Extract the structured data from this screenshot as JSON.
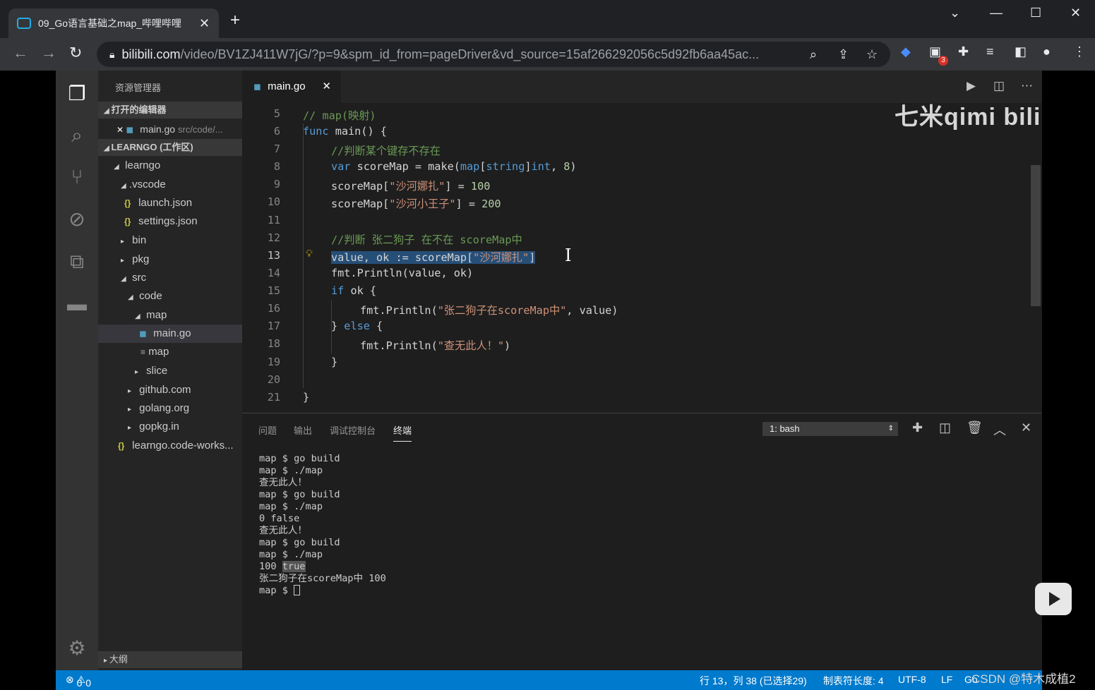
{
  "browser": {
    "tab_title": "09_Go语言基础之map_哔哩哔哩",
    "tab_close": "✕",
    "new_tab": "+",
    "url_domain": "bilibili.com",
    "url_path": "/video/BV1ZJ411W7jG/?p=9&spm_id_from=pageDriver&vd_source=15af266292056c5d92fb6aa45ac...",
    "extension_badge": "3"
  },
  "vscode": {
    "explorer_title": "资源管理器",
    "open_editors": "打开的编辑器",
    "open_file": "main.go",
    "open_file_path": "src/code/...",
    "workspace": "LEARNGO (工作区)",
    "tree": [
      {
        "label": "learngo"
      },
      {
        "label": ".vscode"
      },
      {
        "label": "launch.json"
      },
      {
        "label": "settings.json"
      },
      {
        "label": "bin"
      },
      {
        "label": "pkg"
      },
      {
        "label": "src"
      },
      {
        "label": "code"
      },
      {
        "label": "map"
      },
      {
        "label": "main.go"
      },
      {
        "label": "map"
      },
      {
        "label": "slice"
      },
      {
        "label": "github.com"
      },
      {
        "label": "golang.org"
      },
      {
        "label": "gopkg.in"
      },
      {
        "label": "learngo.code-works..."
      }
    ],
    "outline": "大纲",
    "editor_tab": "main.go",
    "line_numbers": [
      "5",
      "6",
      "7",
      "8",
      "9",
      "10",
      "11",
      "12",
      "13",
      "14",
      "15",
      "16",
      "17",
      "18",
      "19",
      "20",
      "21"
    ],
    "code": {
      "l5": "// map(映射)",
      "l6a": "func",
      "l6b": " main() {",
      "l7": "//判断某个键存不存在",
      "l8a": "var",
      "l8b": " scoreMap = make(",
      "l8c": "map",
      "l8d": "[",
      "l8e": "string",
      "l8f": "]",
      "l8g": "int",
      "l8h": ", ",
      "l8i": "8",
      "l8j": ")",
      "l9a": "scoreMap[",
      "l9b": "\"沙河娜扎\"",
      "l9c": "] = ",
      "l9d": "100",
      "l10a": "scoreMap[",
      "l10b": "\"沙河小王子\"",
      "l10c": "] = ",
      "l10d": "200",
      "l12": "//判断 张二狗子 在不在 scoreMap中",
      "l13a": "value, ok := scoreMap[",
      "l13b": "\"沙河娜扎\"",
      "l13c": "]",
      "l14": "fmt.Println(value, ok)",
      "l15a": "if",
      "l15b": " ok {",
      "l16a": "fmt.Println(",
      "l16b": "\"张二狗子在scoreMap中\"",
      "l16c": ", value)",
      "l17a": "} ",
      "l17b": "else",
      "l17c": " {",
      "l18a": "fmt.Println(",
      "l18b": "\"查无此人！\"",
      "l18c": ")",
      "l19": "}",
      "l21": "}"
    },
    "watermark": "七米qimi bilibili",
    "panel_tabs": [
      "问题",
      "输出",
      "调试控制台",
      "终端"
    ],
    "terminal_select": "1: bash",
    "terminal_lines": [
      "map $ go build",
      "map $ ./map",
      "查无此人！",
      "map $ go build",
      "map $ ./map",
      "0 false",
      "查无此人！",
      "map $ go build",
      "map $ ./map"
    ],
    "terminal_hl_prefix": "100 ",
    "terminal_hl_word": "true",
    "terminal_line_after": "张二狗子在scoreMap中 100",
    "terminal_prompt": "map $ ",
    "status": {
      "errors": "0",
      "warnings": "0",
      "position": "行 13，列 38 (已选择29)",
      "tab_size": "制表符长度: 4",
      "encoding": "UTF-8",
      "eol": "LF",
      "lang": "Go"
    }
  },
  "overlay_credit": "CSDN @特木成植2",
  "colors": {
    "status_bar": "#007acc",
    "selection": "#264f78",
    "keyword": "#569cd6",
    "string": "#ce9178",
    "comment": "#6a9955"
  }
}
